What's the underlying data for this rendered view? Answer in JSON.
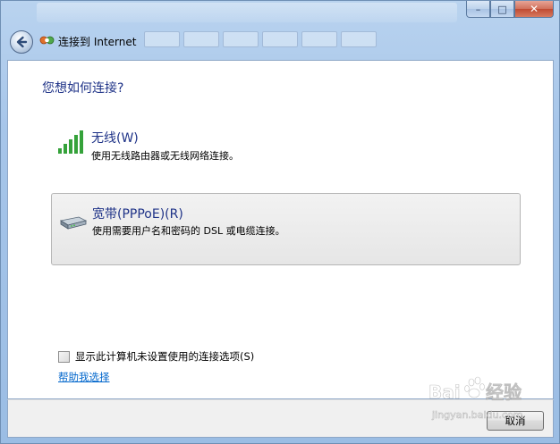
{
  "window": {
    "caption_buttons": {
      "minimize": "–",
      "maximize": "□",
      "close": "✕"
    }
  },
  "wizard": {
    "title": "连接到 Internet",
    "question": "您想如何连接?"
  },
  "options": [
    {
      "title": "无线(W)",
      "description": "使用无线路由器或无线网络连接。",
      "icon": "wireless-signal-icon"
    },
    {
      "title": "宽带(PPPoE)(R)",
      "description": "使用需要用户名和密码的 DSL 或电缆连接。",
      "icon": "broadband-modem-icon"
    }
  ],
  "checkbox": {
    "label": "显示此计算机未设置使用的连接选项(S)",
    "checked": false
  },
  "help_link": "帮助我选择",
  "footer": {
    "cancel_label": "取消"
  },
  "colors": {
    "heading": "#1e3287",
    "link": "#0066cc",
    "selected_option_bg": "#e9e9e9"
  }
}
